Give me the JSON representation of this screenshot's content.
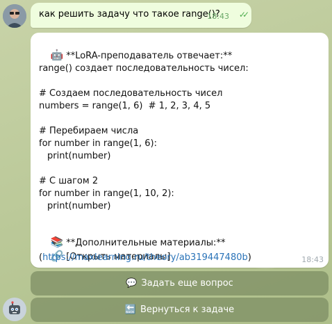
{
  "user_message": {
    "text": "как решить задачу что такое range()?",
    "time": "18:43",
    "ticks": "✓✓"
  },
  "bot_message": {
    "header_emoji": "🤖",
    "header": "**LoRA-преподаватель отвечает:**",
    "lines": [
      "range() создает последовательность чисел:",
      "# Создаем последовательность чисел",
      "numbers = range(1, 6)  # 1, 2, 3, 4, 5",
      "# Перебираем числа",
      "for number in range(1, 6):",
      "print(number)",
      "# С шагом 2",
      "for number in range(1, 10, 2):",
      "print(number)"
    ],
    "materials_emoji": "📚",
    "materials_title": "**Дополнительные материалы:**",
    "link_emoji": "🔗",
    "link_label": "[Открыть материалы]",
    "link_open": "(",
    "link_url": "https://maxlearning.ru/theory/ab319447480b",
    "link_close": ")",
    "time": "18:43"
  },
  "buttons": [
    {
      "icon": "💬",
      "label": "Задать еще вопрос"
    },
    {
      "icon": "🔙",
      "label": "Вернуться к задаче"
    }
  ]
}
